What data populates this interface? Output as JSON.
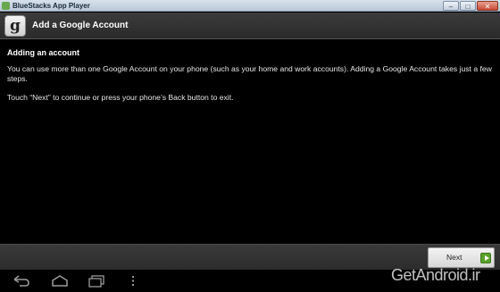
{
  "window": {
    "title": "BlueStacks App Player",
    "minimize_glyph": "–",
    "maximize_glyph": "□",
    "close_glyph": "✕"
  },
  "header": {
    "icon_letter": "g",
    "title": "Add a Google Account"
  },
  "content": {
    "section_title": "Adding an account",
    "paragraph1": "You can use more than one Google Account on your phone (such as your home and work accounts). Adding a Google Account takes just a few steps.",
    "paragraph2": "Touch “Next” to continue or press your phone’s Back button to exit."
  },
  "footer": {
    "next_label": "Next"
  },
  "navbar": {
    "icons": [
      "back-icon",
      "home-icon",
      "recent-apps-icon",
      "menu-icon"
    ]
  },
  "watermark": "GetAndroid.ir",
  "colors": {
    "background": "#000000",
    "header_bg": "#333333",
    "next_icon": "#5aa02c"
  }
}
